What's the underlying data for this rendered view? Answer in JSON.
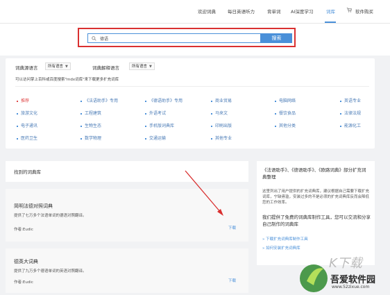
{
  "nav": {
    "items": [
      "欢迎词典",
      "每日英语听力",
      "背单词",
      "AI深度学习",
      "词库"
    ],
    "buy": "软件购买",
    "active_index": 4
  },
  "search": {
    "value": "德语",
    "button": "搜索"
  },
  "filters": {
    "source_label": "词典源语言",
    "source_value": "所有语言",
    "target_label": "词典解释语言",
    "target_value": "所有语言",
    "hint": "可以访问掌上百科或百度搜索\"mdx词库\"来下载更多扩充词库"
  },
  "categories": {
    "rows": [
      [
        "推荐",
        "《法语助手》专用",
        "《德语助手》专用",
        "商业贸易",
        "电脑网络",
        "英语专业"
      ],
      [
        "旅游文化",
        "工程建筑",
        "外语考试",
        "马来文",
        "餐饮食品",
        "法律法规"
      ],
      [
        "电子通讯",
        "生物生态",
        "手机版词典库",
        "印刷出版",
        "其他分类",
        "能源化工"
      ],
      [
        "医药卫生",
        "数学物理",
        "交通运输",
        "其他专业",
        "",
        ""
      ]
    ],
    "active": "推荐"
  },
  "results": {
    "title": "找到的词典库",
    "items": [
      {
        "name": "简明法德对照词典",
        "desc": "提供了七万多个法语单词的德语对照翻译。",
        "author": "作者:Eudic",
        "download": "下载"
      },
      {
        "name": "德英大词典",
        "desc": "提供了九万多个德语单词的英语对照翻译。",
        "author": "作者:Eudic",
        "download": "下载"
      }
    ]
  },
  "sidebar": {
    "title": "《法语助手》、《德语助手》、《欧路词典》部分扩充词典整理",
    "text": "这里列出了用户提供的扩充词典库，建议根据自己需要下载扩充词库，宁缺毋滥，安装过多的不是必须的扩充词典库反而会降低您的工作效率。",
    "em": "我们提供了免费的词典库制作工具，您可以交流和分享自己制作的词典库",
    "links": [
      "» 下载扩充词典库制作工具",
      "» 如何安装扩充词典库"
    ]
  },
  "watermark": {
    "name": "吾爱软件园",
    "site": "www.52zixue.com"
  },
  "colors": {
    "accent": "#4a90d9",
    "highlight": "#d93030",
    "background": "#f1f2f4"
  }
}
